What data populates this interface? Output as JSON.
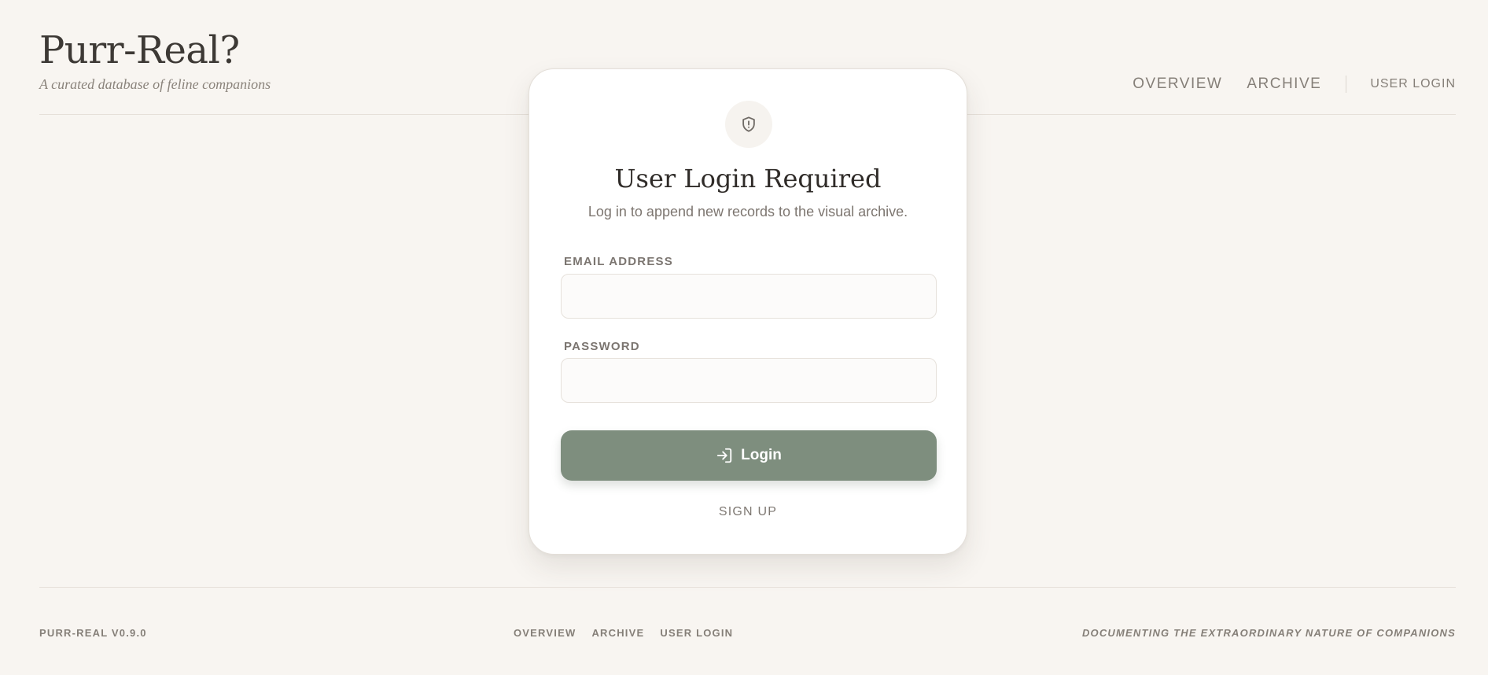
{
  "brand": {
    "title": "Purr-Real?",
    "tagline": "A curated database of feline companions"
  },
  "nav": {
    "items": [
      {
        "label": "OVERVIEW"
      },
      {
        "label": "ARCHIVE"
      }
    ],
    "login_label": "USER LOGIN"
  },
  "card": {
    "icon": "shield-alert-icon",
    "title": "User Login Required",
    "subtitle": "Log in to append new records to the visual archive.",
    "email": {
      "label": "EMAIL ADDRESS",
      "value": "",
      "placeholder": ""
    },
    "password": {
      "label": "PASSWORD",
      "value": "",
      "placeholder": ""
    },
    "login_button": {
      "label": "Login",
      "icon": "log-in-icon"
    },
    "signup_label": "SIGN UP"
  },
  "footer": {
    "version": "PURR-REAL V0.9.0",
    "links": [
      {
        "label": "OVERVIEW"
      },
      {
        "label": "ARCHIVE"
      },
      {
        "label": "USER LOGIN"
      }
    ],
    "tagline": "DOCUMENTING THE EXTRAORDINARY NATURE OF COMPANIONS"
  },
  "colors": {
    "background": "#f8f5f1",
    "accent": "#7e8e7e",
    "text_muted": "#857f78"
  }
}
